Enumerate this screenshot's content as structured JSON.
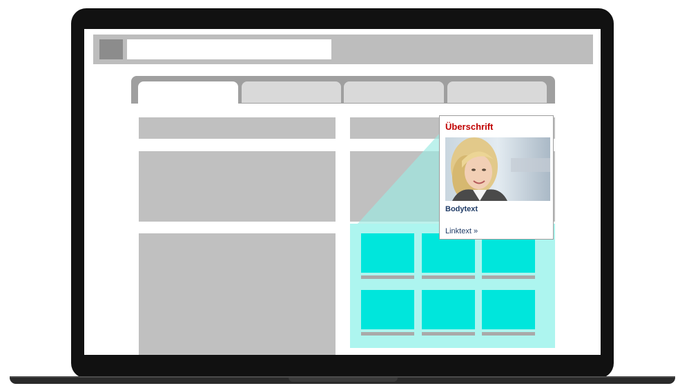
{
  "card": {
    "title": "Überschrift",
    "body": "Bodytext",
    "link": "Linktext »"
  },
  "colors": {
    "teal_light": "#adf5ef",
    "teal": "#00e6dc",
    "title_red": "#c00000",
    "text_navy": "#1f3b66"
  },
  "icons": {
    "favicon": "site-favicon-icon"
  }
}
